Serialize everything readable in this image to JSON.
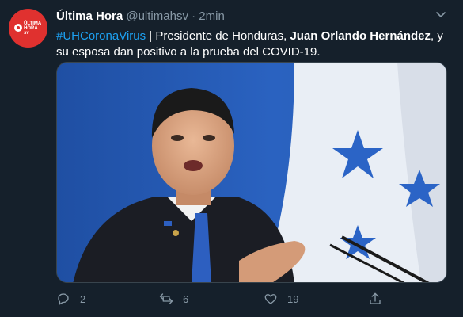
{
  "author": {
    "name": "Última Hora",
    "handle": "@ultimahsv",
    "separator": "·",
    "time": "2min",
    "avatar_text_line1": "ÚLTIMA",
    "avatar_text_line2": "HORA",
    "avatar_text_line3": "sv"
  },
  "tweet": {
    "hashtag": "#UHCoronaVirus",
    "part1": " | Presidente de Honduras, ",
    "bold_name": "Juan Orlando Hernández",
    "part2": ", y su esposa dan positivo a la prueba del COVID-19."
  },
  "actions": {
    "reply_count": "2",
    "retweet_count": "6",
    "like_count": "19"
  },
  "colors": {
    "background": "#15202b",
    "accent": "#1da1f2",
    "muted": "#8899a6",
    "avatar_red": "#e0312f"
  }
}
